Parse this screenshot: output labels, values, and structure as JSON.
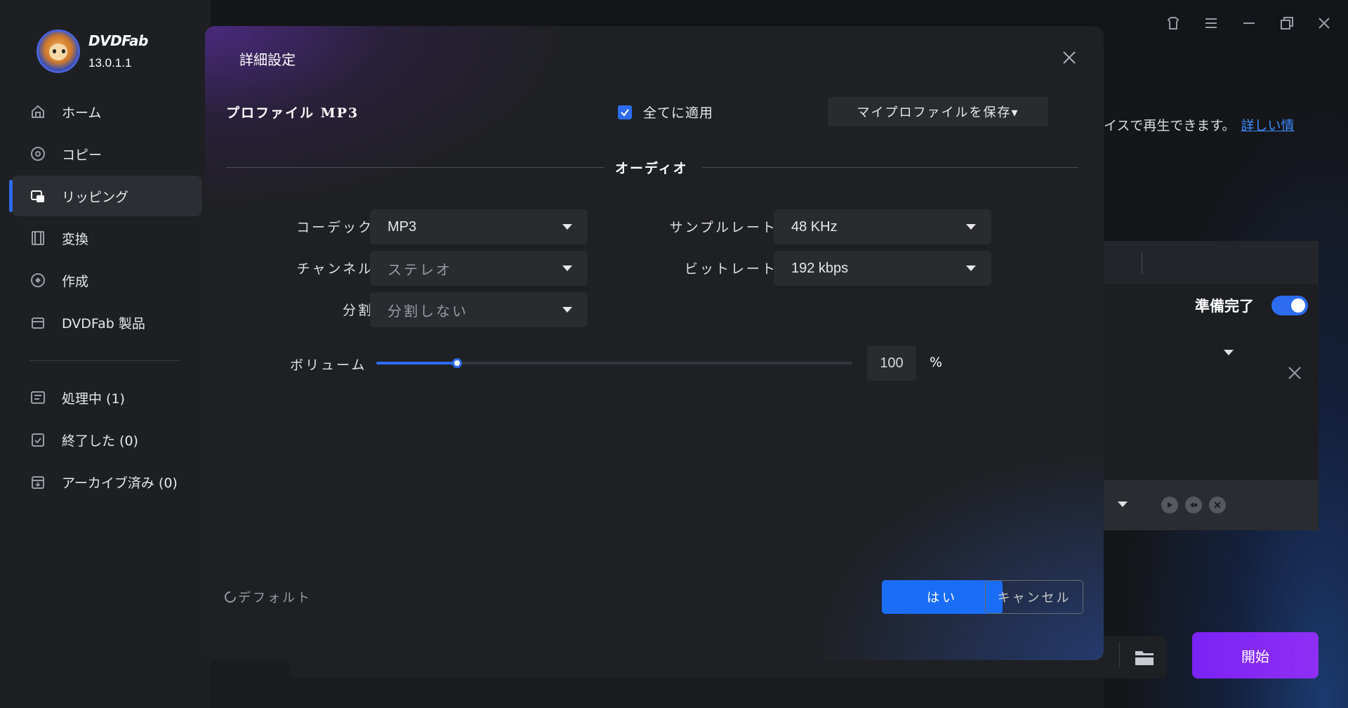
{
  "app": {
    "brand": "DVDFab",
    "version": "13.0.1.1"
  },
  "sidebar": {
    "items": [
      {
        "label": "ホーム",
        "icon": "home-icon"
      },
      {
        "label": "コピー",
        "icon": "copy-disc-icon"
      },
      {
        "label": "リッピング",
        "icon": "ripper-icon",
        "active": true
      },
      {
        "label": "変換",
        "icon": "film-icon"
      },
      {
        "label": "作成",
        "icon": "disc-create-icon"
      },
      {
        "label": "DVDFab 製品",
        "icon": "products-icon"
      }
    ],
    "queue": [
      {
        "label": "処理中 (1)",
        "icon": "processing-icon"
      },
      {
        "label": "終了した (0)",
        "icon": "finished-icon"
      },
      {
        "label": "アーカイブ済み (0)",
        "icon": "archive-icon"
      }
    ]
  },
  "background": {
    "info_text": "イスで再生できます。",
    "info_link": "詳しい情",
    "ready_label": "準備完了",
    "ready_toggle_on": true,
    "start_button": "開始"
  },
  "dialog": {
    "title": "詳細設定",
    "profile_label": "プロファイル MP3",
    "apply_all_label": "全てに適用",
    "apply_all_checked": true,
    "save_profile_label": "マイプロファイルを保存▾",
    "section_title": "オーディオ",
    "fields": {
      "codec": {
        "label": "コーデック",
        "value": "MP3"
      },
      "channel": {
        "label": "チャンネル",
        "value": "ステレオ"
      },
      "split": {
        "label": "分割",
        "value": "分割しない"
      },
      "sample_rate": {
        "label": "サンプルレート",
        "value": "48 KHz"
      },
      "bitrate": {
        "label": "ビットレート",
        "value": "192 kbps"
      }
    },
    "volume": {
      "label": "ボリューム",
      "value": "100",
      "unit": "%",
      "slider_fraction": 0.17
    },
    "default_label": "デフォルト",
    "ok_label": "はい",
    "cancel_label": "キャンセル"
  },
  "colors": {
    "accent": "#2d6cf0",
    "start_button": "#7b22f5"
  }
}
